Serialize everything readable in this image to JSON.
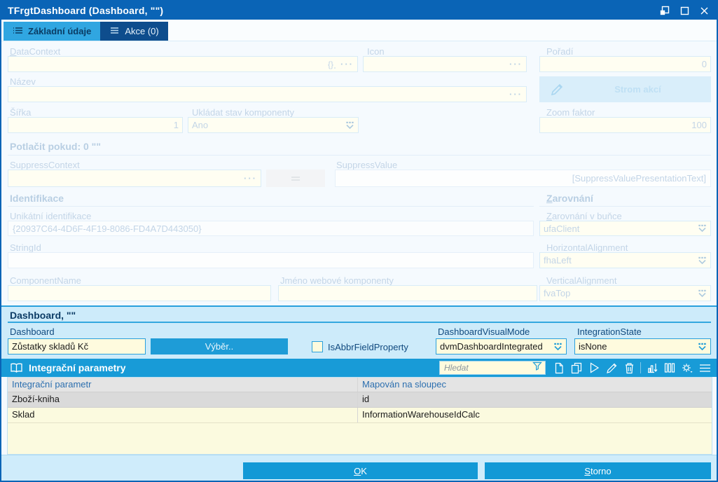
{
  "window": {
    "title": "TFrgtDashboard (Dashboard, \"\")",
    "controls": [
      "dock-icon",
      "maximize-icon",
      "close-icon"
    ]
  },
  "tabs": {
    "basic": "Základní údaje",
    "actions": "Akce (0)"
  },
  "form": {
    "datacontext": {
      "label": "DataContext",
      "value": ""
    },
    "icon": {
      "label": "Icon",
      "value": ""
    },
    "poradi": {
      "label": "Pořadí",
      "value": "0"
    },
    "nazev": {
      "label": "Název",
      "value": ""
    },
    "strom_akci_button": "Strom akcí",
    "sirka": {
      "label": "Šířka",
      "value": "1"
    },
    "ukladat_stav": {
      "label": "Ukládat stav komponenty",
      "value": "Ano"
    },
    "zoom_faktor": {
      "label": "Zoom faktor",
      "value": "100"
    },
    "potlacit_header": "Potlačit pokud:  0 \"\"",
    "suppress_context": {
      "label": "SuppressContext",
      "value": ""
    },
    "suppress_value": {
      "label": "SuppressValue",
      "value": "[SuppressValuePresentationText]"
    },
    "identifikace_header": "Identifikace",
    "zarovnani_header": "Zarovnání",
    "unikatni": {
      "label": "Unikátní identifikace",
      "value": "{20937C64-4D6F-4F19-8086-FD4A7D443050}"
    },
    "zarovnani_bunce": {
      "label": "Zarovnání v buňce",
      "value": "ufaClient"
    },
    "stringid": {
      "label": "StringId",
      "value": ""
    },
    "horizontal_alignment": {
      "label": "HorizontalAlignment",
      "value": "fhaLeft"
    },
    "componentname": {
      "label": "ComponentName",
      "value": ""
    },
    "jmeno_web": {
      "label": "Jméno webové komponenty",
      "value": ""
    },
    "vertical_alignment": {
      "label": "VerticalAlignment",
      "value": "fvaTop"
    }
  },
  "dashboard": {
    "header": "Dashboard, \"\"",
    "dashboard_field": {
      "label": "Dashboard",
      "value": "Zůstatky skladů Kč"
    },
    "vyber_button": "Výběr..",
    "isabbr": {
      "label": "IsAbbrFieldProperty",
      "checked": false
    },
    "visual_mode": {
      "label": "DashboardVisualMode",
      "value": "dvmDashboardIntegrated"
    },
    "integration_state": {
      "label": "IntegrationState",
      "value": "isNone"
    }
  },
  "grid": {
    "title": "Integrační parametry",
    "search_placeholder": "Hledat",
    "toolbar_icons": [
      "filter-funnel-icon",
      "new-document-icon",
      "copy-icon",
      "run-icon",
      "edit-pencil-icon",
      "delete-trash-icon",
      "chart-export-icon",
      "columns-icon",
      "settings-gear-icon",
      "menu-icon"
    ],
    "columns": {
      "param": "Integrační parametr",
      "mapped": "Mapován na sloupec"
    },
    "rows": [
      {
        "param": "Zboží-kniha",
        "column": "id",
        "selected": true
      },
      {
        "param": "Sklad",
        "column": "InformationWarehouseIdCalc",
        "selected": false
      }
    ]
  },
  "footer": {
    "ok": "OK",
    "cancel": "Storno"
  },
  "colors": {
    "titlebar": "#0A64B6",
    "accent_blue": "#1E9CD7",
    "tab_active": "#30A6E1",
    "tab_inactive": "#0E4D8D",
    "panel_bg": "#CDEBFA",
    "input_yellow": "#FEFBDE",
    "row_selected": "#DADADA",
    "grid_yellow": "#FBFADF"
  }
}
